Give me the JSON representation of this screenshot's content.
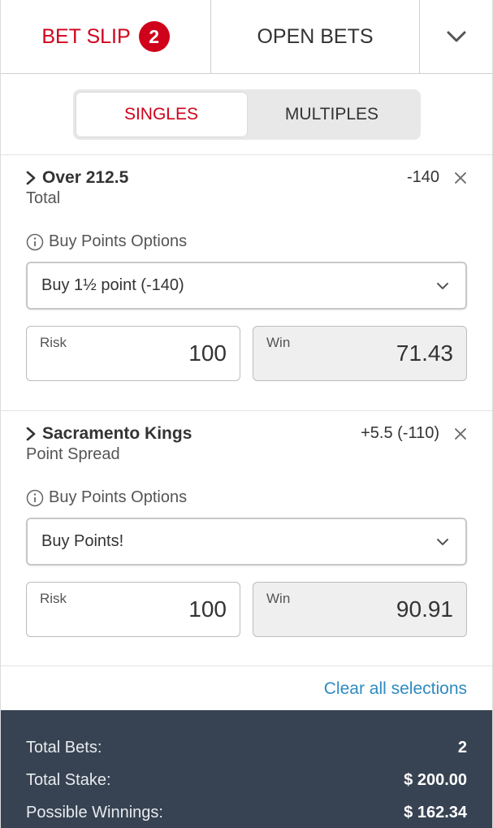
{
  "header": {
    "bet_slip_label": "BET SLIP",
    "bet_slip_count": "2",
    "open_bets_label": "OPEN BETS"
  },
  "segment": {
    "singles": "SINGLES",
    "multiples": "MULTIPLES",
    "active": "SINGLES"
  },
  "bets": [
    {
      "title": "Over  212.5",
      "odds": "-140",
      "type": "Total",
      "buy_points_label": "Buy Points Options",
      "select_value": "Buy 1½ point (-140)",
      "risk_label": "Risk",
      "risk_value": "100",
      "win_label": "Win",
      "win_value": "71.43"
    },
    {
      "title": "Sacramento Kings",
      "odds": "+5.5 (-110)",
      "type": "Point Spread",
      "buy_points_label": "Buy Points Options",
      "select_value": "Buy Points!",
      "risk_label": "Risk",
      "risk_value": "100",
      "win_label": "Win",
      "win_value": "90.91"
    }
  ],
  "clear_all": "Clear all selections",
  "summary": {
    "total_bets_label": "Total Bets:",
    "total_bets_value": "2",
    "total_stake_label": "Total Stake:",
    "total_stake_value": "$ 200.00",
    "possible_winnings_label": "Possible Winnings:",
    "possible_winnings_value": "$ 162.34"
  },
  "colors": {
    "accent_red": "#d0021b",
    "link_blue": "#2e8bc0",
    "footer_bg": "#374352"
  }
}
